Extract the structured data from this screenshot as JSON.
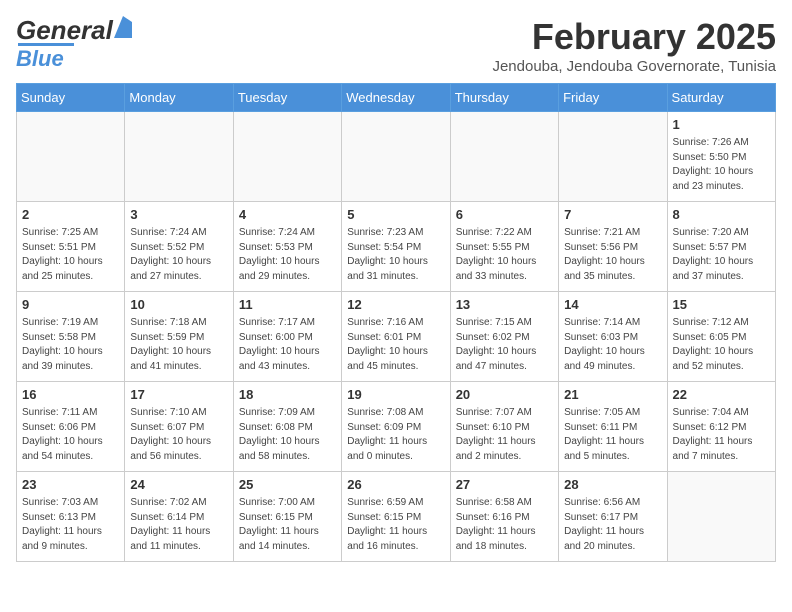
{
  "header": {
    "logo_general": "General",
    "logo_blue": "Blue",
    "title": "February 2025",
    "subtitle": "Jendouba, Jendouba Governorate, Tunisia"
  },
  "days_of_week": [
    "Sunday",
    "Monday",
    "Tuesday",
    "Wednesday",
    "Thursday",
    "Friday",
    "Saturday"
  ],
  "weeks": [
    [
      {
        "day": "",
        "info": ""
      },
      {
        "day": "",
        "info": ""
      },
      {
        "day": "",
        "info": ""
      },
      {
        "day": "",
        "info": ""
      },
      {
        "day": "",
        "info": ""
      },
      {
        "day": "",
        "info": ""
      },
      {
        "day": "1",
        "info": "Sunrise: 7:26 AM\nSunset: 5:50 PM\nDaylight: 10 hours and 23 minutes."
      }
    ],
    [
      {
        "day": "2",
        "info": "Sunrise: 7:25 AM\nSunset: 5:51 PM\nDaylight: 10 hours and 25 minutes."
      },
      {
        "day": "3",
        "info": "Sunrise: 7:24 AM\nSunset: 5:52 PM\nDaylight: 10 hours and 27 minutes."
      },
      {
        "day": "4",
        "info": "Sunrise: 7:24 AM\nSunset: 5:53 PM\nDaylight: 10 hours and 29 minutes."
      },
      {
        "day": "5",
        "info": "Sunrise: 7:23 AM\nSunset: 5:54 PM\nDaylight: 10 hours and 31 minutes."
      },
      {
        "day": "6",
        "info": "Sunrise: 7:22 AM\nSunset: 5:55 PM\nDaylight: 10 hours and 33 minutes."
      },
      {
        "day": "7",
        "info": "Sunrise: 7:21 AM\nSunset: 5:56 PM\nDaylight: 10 hours and 35 minutes."
      },
      {
        "day": "8",
        "info": "Sunrise: 7:20 AM\nSunset: 5:57 PM\nDaylight: 10 hours and 37 minutes."
      }
    ],
    [
      {
        "day": "9",
        "info": "Sunrise: 7:19 AM\nSunset: 5:58 PM\nDaylight: 10 hours and 39 minutes."
      },
      {
        "day": "10",
        "info": "Sunrise: 7:18 AM\nSunset: 5:59 PM\nDaylight: 10 hours and 41 minutes."
      },
      {
        "day": "11",
        "info": "Sunrise: 7:17 AM\nSunset: 6:00 PM\nDaylight: 10 hours and 43 minutes."
      },
      {
        "day": "12",
        "info": "Sunrise: 7:16 AM\nSunset: 6:01 PM\nDaylight: 10 hours and 45 minutes."
      },
      {
        "day": "13",
        "info": "Sunrise: 7:15 AM\nSunset: 6:02 PM\nDaylight: 10 hours and 47 minutes."
      },
      {
        "day": "14",
        "info": "Sunrise: 7:14 AM\nSunset: 6:03 PM\nDaylight: 10 hours and 49 minutes."
      },
      {
        "day": "15",
        "info": "Sunrise: 7:12 AM\nSunset: 6:05 PM\nDaylight: 10 hours and 52 minutes."
      }
    ],
    [
      {
        "day": "16",
        "info": "Sunrise: 7:11 AM\nSunset: 6:06 PM\nDaylight: 10 hours and 54 minutes."
      },
      {
        "day": "17",
        "info": "Sunrise: 7:10 AM\nSunset: 6:07 PM\nDaylight: 10 hours and 56 minutes."
      },
      {
        "day": "18",
        "info": "Sunrise: 7:09 AM\nSunset: 6:08 PM\nDaylight: 10 hours and 58 minutes."
      },
      {
        "day": "19",
        "info": "Sunrise: 7:08 AM\nSunset: 6:09 PM\nDaylight: 11 hours and 0 minutes."
      },
      {
        "day": "20",
        "info": "Sunrise: 7:07 AM\nSunset: 6:10 PM\nDaylight: 11 hours and 2 minutes."
      },
      {
        "day": "21",
        "info": "Sunrise: 7:05 AM\nSunset: 6:11 PM\nDaylight: 11 hours and 5 minutes."
      },
      {
        "day": "22",
        "info": "Sunrise: 7:04 AM\nSunset: 6:12 PM\nDaylight: 11 hours and 7 minutes."
      }
    ],
    [
      {
        "day": "23",
        "info": "Sunrise: 7:03 AM\nSunset: 6:13 PM\nDaylight: 11 hours and 9 minutes."
      },
      {
        "day": "24",
        "info": "Sunrise: 7:02 AM\nSunset: 6:14 PM\nDaylight: 11 hours and 11 minutes."
      },
      {
        "day": "25",
        "info": "Sunrise: 7:00 AM\nSunset: 6:15 PM\nDaylight: 11 hours and 14 minutes."
      },
      {
        "day": "26",
        "info": "Sunrise: 6:59 AM\nSunset: 6:15 PM\nDaylight: 11 hours and 16 minutes."
      },
      {
        "day": "27",
        "info": "Sunrise: 6:58 AM\nSunset: 6:16 PM\nDaylight: 11 hours and 18 minutes."
      },
      {
        "day": "28",
        "info": "Sunrise: 6:56 AM\nSunset: 6:17 PM\nDaylight: 11 hours and 20 minutes."
      },
      {
        "day": "",
        "info": ""
      }
    ]
  ]
}
